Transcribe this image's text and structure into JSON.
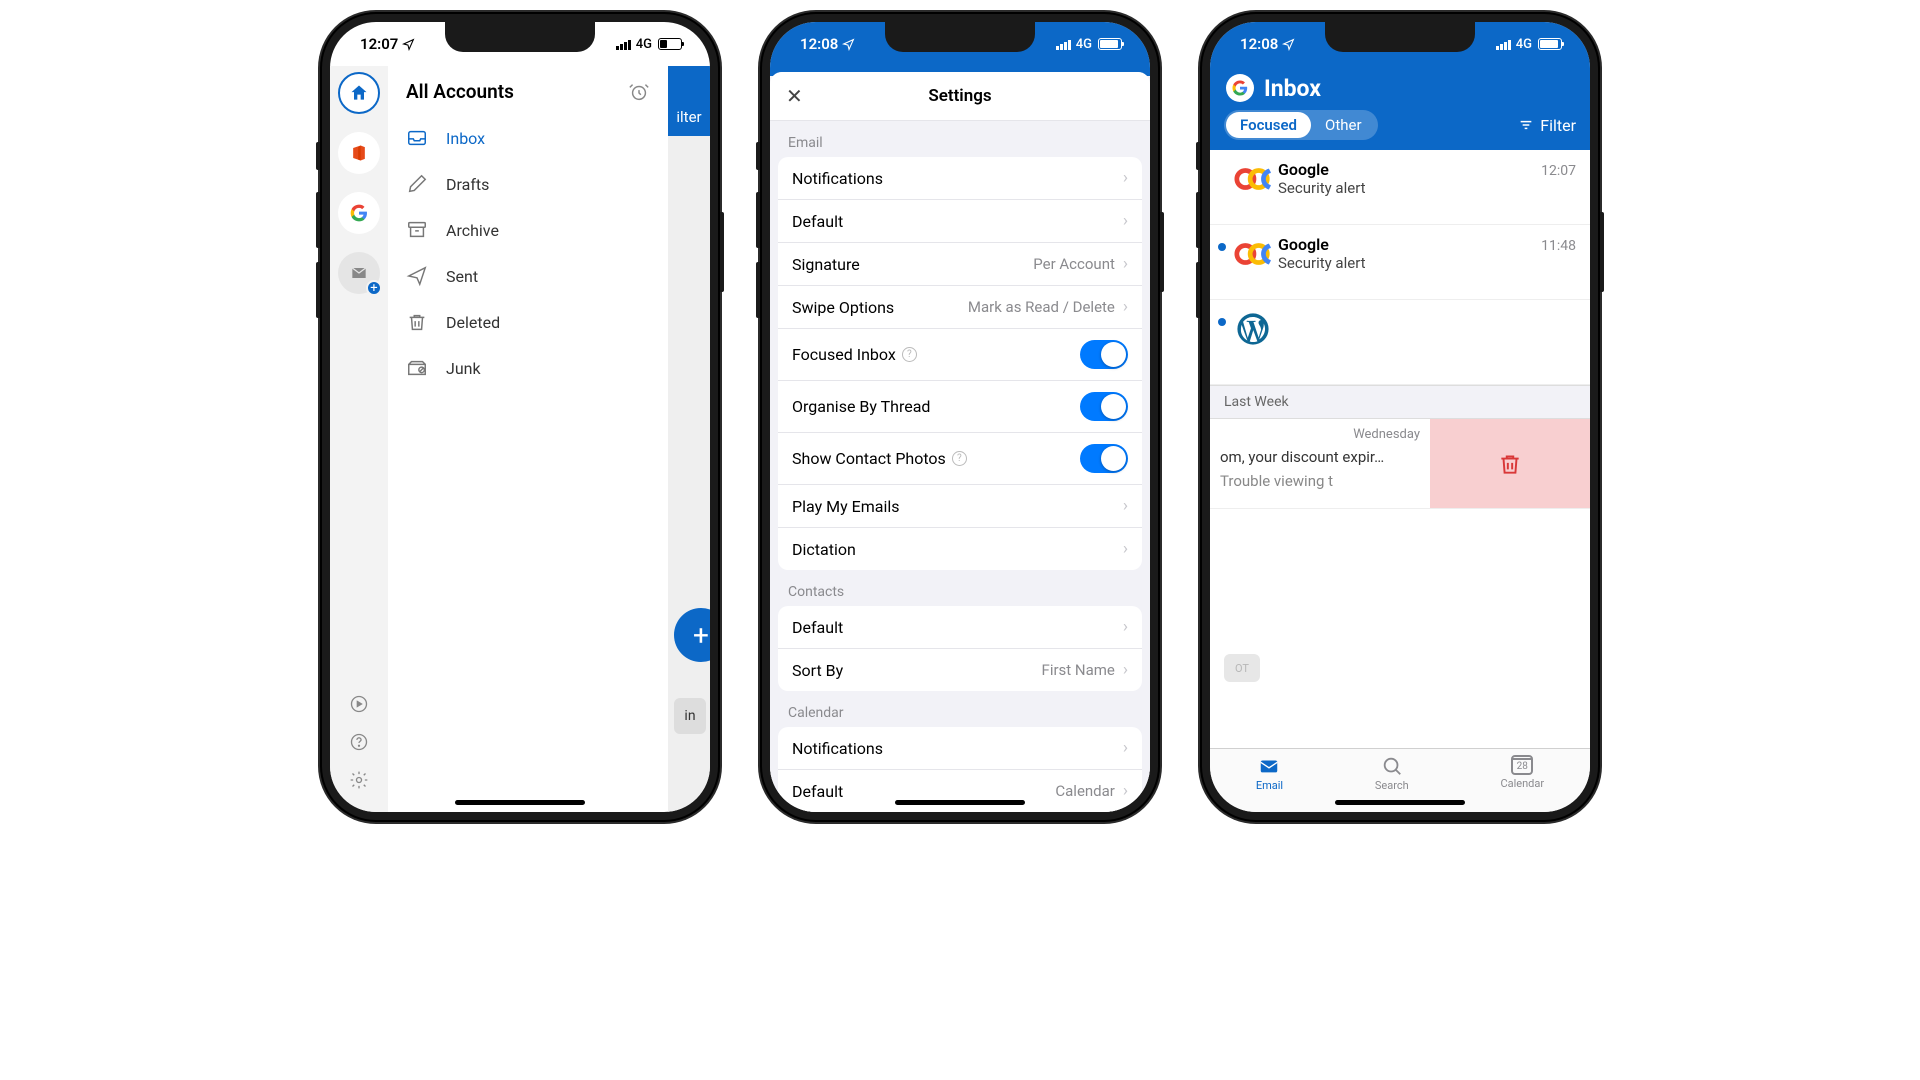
{
  "phone1": {
    "status": {
      "time": "12:07",
      "network": "4G"
    },
    "header": {
      "title": "All Accounts"
    },
    "folders": {
      "inbox": "Inbox",
      "drafts": "Drafts",
      "archive": "Archive",
      "sent": "Sent",
      "deleted": "Deleted",
      "junk": "Junk"
    },
    "slice": {
      "filter": "ilter",
      "compose": "+",
      "inbtn": "in"
    }
  },
  "phone2": {
    "status": {
      "time": "12:08",
      "network": "4G"
    },
    "title": "Settings",
    "sections": {
      "email_label": "Email",
      "contacts_label": "Contacts",
      "calendar_label": "Calendar"
    },
    "email": {
      "notifications": "Notifications",
      "default": "Default",
      "signature": {
        "label": "Signature",
        "value": "Per Account"
      },
      "swipe": {
        "label": "Swipe Options",
        "value": "Mark as Read / Delete"
      },
      "focused": "Focused Inbox",
      "thread": "Organise By Thread",
      "photos": "Show Contact Photos",
      "play": "Play My Emails",
      "dictation": "Dictation"
    },
    "contacts": {
      "default": "Default",
      "sort": {
        "label": "Sort By",
        "value": "First Name"
      }
    },
    "calendar": {
      "notifications": "Notifications",
      "default": {
        "label": "Default",
        "value": "Calendar"
      }
    }
  },
  "phone3": {
    "status": {
      "time": "12:08",
      "network": "4G"
    },
    "header": {
      "title": "Inbox",
      "focused": "Focused",
      "other": "Other",
      "filter": "Filter"
    },
    "messages": [
      {
        "sender": "Google",
        "subject": "Security alert",
        "time": "12:07"
      },
      {
        "sender": "Google",
        "subject": "Security alert",
        "time": "11:48"
      }
    ],
    "section_lastweek": "Last Week",
    "swiped": {
      "day": "Wednesday",
      "line1": "om, your discount expir…",
      "line2": "Trouble viewing t"
    },
    "tabs": {
      "email": "Email",
      "search": "Search",
      "calendar": "Calendar",
      "cal_day": "28"
    },
    "ghost": "OT"
  }
}
